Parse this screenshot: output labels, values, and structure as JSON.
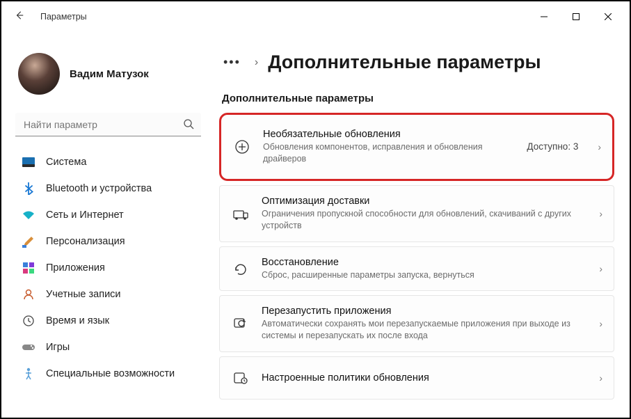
{
  "titlebar": {
    "title": "Параметры"
  },
  "user": {
    "name": "Вадим Матузок"
  },
  "search": {
    "placeholder": "Найти параметр"
  },
  "nav": [
    {
      "label": "Система"
    },
    {
      "label": "Bluetooth и устройства"
    },
    {
      "label": "Сеть и Интернет"
    },
    {
      "label": "Персонализация"
    },
    {
      "label": "Приложения"
    },
    {
      "label": "Учетные записи"
    },
    {
      "label": "Время и язык"
    },
    {
      "label": "Игры"
    },
    {
      "label": "Специальные возможности"
    }
  ],
  "breadcrumb": {
    "title": "Дополнительные параметры"
  },
  "section_label": "Дополнительные параметры",
  "cards": {
    "optional_updates": {
      "title": "Необязательные обновления",
      "sub": "Обновления компонентов, исправления и обновления драйверов",
      "badge": "Доступно: 3"
    },
    "delivery": {
      "title": "Оптимизация доставки",
      "sub": "Ограничения пропускной способности для обновлений, скачиваний с других устройств"
    },
    "recovery": {
      "title": "Восстановление",
      "sub": "Сброс, расширенные параметры запуска, вернуться"
    },
    "restart_apps": {
      "title": "Перезапустить приложения",
      "sub": "Автоматически сохранять мои перезапускаемые приложения при выходе из системы и перезапускать их после входа"
    },
    "policies": {
      "title": "Настроенные политики обновления"
    }
  }
}
